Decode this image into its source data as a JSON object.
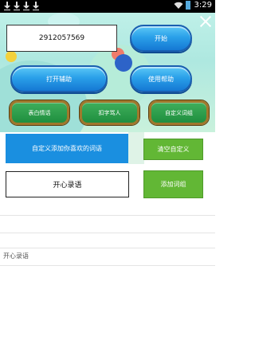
{
  "status_bar": {
    "time": "3:29",
    "icons": [
      "download-icon",
      "download-icon",
      "download-icon",
      "download-icon",
      "wifi-icon",
      "battery-icon"
    ]
  },
  "panel": {
    "qq_number": "2912057569",
    "start_label": "开始",
    "open_assist_label": "打开辅助",
    "help_label": "使用帮助",
    "chips": [
      "表白情话",
      "扣字骂人",
      "自定义词组"
    ]
  },
  "custom": {
    "description": "自定义添加你喜欢的词语",
    "clear_label": "清空自定义",
    "input_value": "开心录语",
    "add_label": "添加词组"
  },
  "list": {
    "items": [
      "开心录语"
    ]
  },
  "colors": {
    "accent_blue": "#1a8fe0",
    "green_button": "#62b735",
    "chip_green": "#1f8f3f",
    "chip_border": "#a0782c"
  }
}
